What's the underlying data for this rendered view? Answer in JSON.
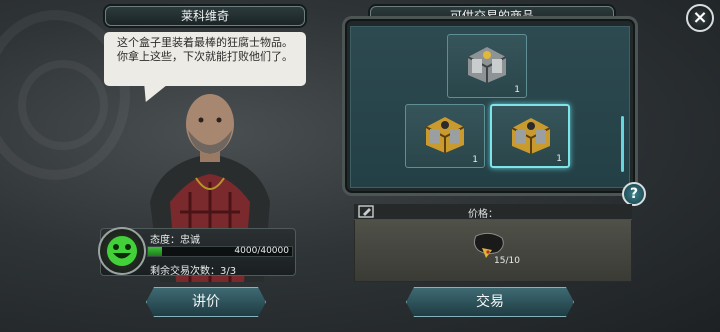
{
  "npc": {
    "name": "莱科维奇",
    "speech": "这个盒子里装着最棒的狂腐士物品。你拿上这些，下次就能打败他们了。",
    "attitude": "态度：忠诚",
    "reputation_text": "4000/40000",
    "reputation_fraction": 0.1,
    "trades_remaining": "剩余交易次数：3/3"
  },
  "shop": {
    "title": "可供交易的商品",
    "items": [
      {
        "icon": "silver-crate-icon",
        "qty": "1"
      },
      {
        "icon": "gold-crate-icon",
        "qty": "1"
      },
      {
        "icon": "gold-crate-icon",
        "qty": "1"
      }
    ],
    "price_label": "价格：",
    "price_amount": "15/10",
    "price_icon": "gold-nuggets-icon"
  },
  "buttons": {
    "bargain": "讲价",
    "trade": "交易",
    "help": "?",
    "close": "×"
  },
  "colors": {
    "bar_green": "#3fbf3a",
    "selection_cyan": "#7fe3ea"
  }
}
